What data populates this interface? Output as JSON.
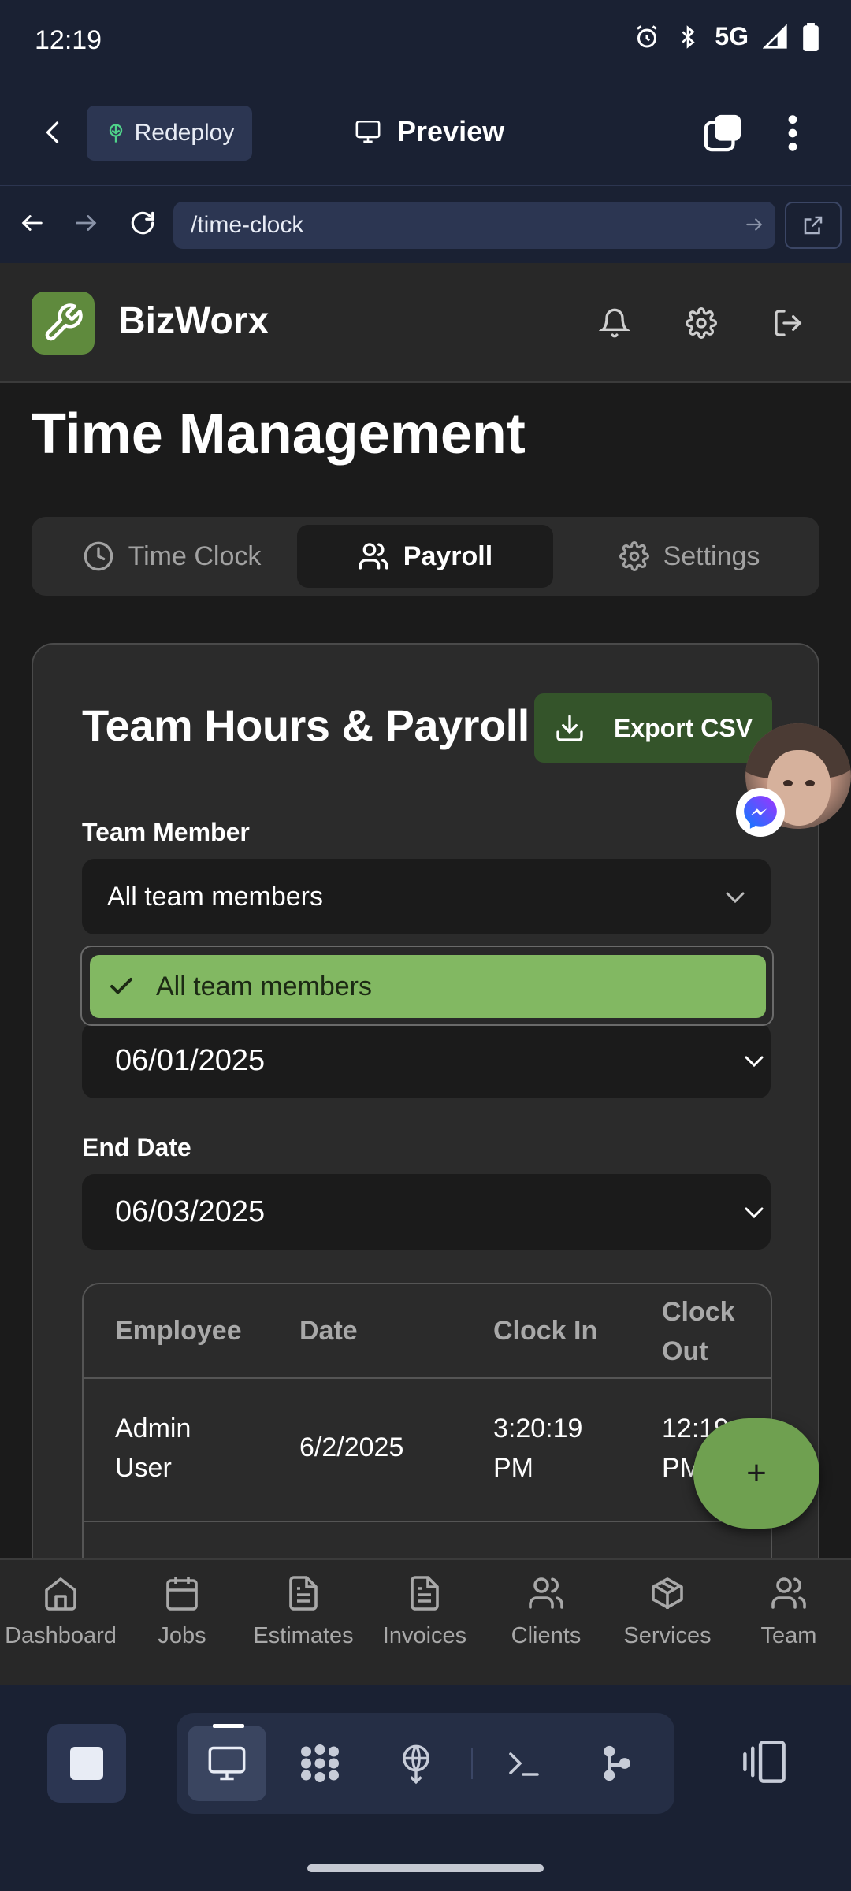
{
  "status_bar": {
    "time": "12:19",
    "network": "5G"
  },
  "replit": {
    "redeploy_label": "Redeploy",
    "preview_label": "Preview",
    "url": "/time-clock"
  },
  "app": {
    "name": "BizWorx",
    "page_title": "Time Management",
    "tabs": [
      {
        "label": "Time Clock",
        "icon": "clock-icon",
        "active": false
      },
      {
        "label": "Payroll",
        "icon": "users-icon",
        "active": true
      },
      {
        "label": "Settings",
        "icon": "gear-icon",
        "active": false
      }
    ]
  },
  "card": {
    "title": "Team Hours & Payroll",
    "export_label": "Export CSV",
    "team_member_label": "Team Member",
    "team_member_value": "All team members",
    "dropdown_options": [
      "All team members"
    ],
    "start_date_value": "06/01/2025",
    "end_date_label": "End Date",
    "end_date_value": "06/03/2025",
    "table": {
      "headers": [
        "Employee",
        "Date",
        "Clock In",
        "Clock Out"
      ],
      "rows": [
        {
          "employee": "Admin User",
          "date": "6/2/2025",
          "clock_in": "3:20:19 PM",
          "clock_out": "12:19 PM"
        }
      ]
    }
  },
  "fab_label": "+",
  "bottom_nav": [
    {
      "label": "Dashboard",
      "icon": "home-icon"
    },
    {
      "label": "Jobs",
      "icon": "calendar-icon"
    },
    {
      "label": "Estimates",
      "icon": "document-icon"
    },
    {
      "label": "Invoices",
      "icon": "document-icon"
    },
    {
      "label": "Clients",
      "icon": "users-icon"
    },
    {
      "label": "Services",
      "icon": "package-icon"
    },
    {
      "label": "Team",
      "icon": "users-icon"
    }
  ],
  "colors": {
    "accent_green": "#82b862",
    "export_green": "#34542a",
    "fab_green": "#6fa050",
    "replit_navy": "#1a2133",
    "app_background": "#1b1b1b"
  }
}
